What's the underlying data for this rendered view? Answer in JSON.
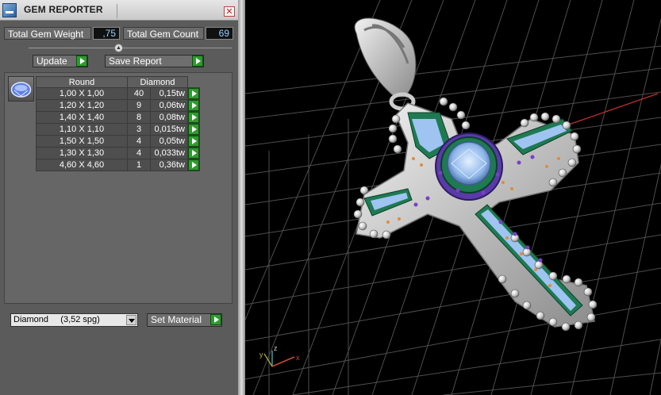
{
  "panel": {
    "title": "GEM REPORTER",
    "total_weight_label": "Total Gem Weight",
    "total_weight_value": ",75",
    "total_count_label": "Total Gem Count",
    "total_count_value": "69",
    "update_label": "Update",
    "save_report_label": "Save Report",
    "table": {
      "headers": [
        "Round",
        "Diamond"
      ],
      "rows": [
        {
          "size": "1,00 X 1,00",
          "count": "40",
          "weight": "0,15tw"
        },
        {
          "size": "1,20 X 1,20",
          "count": "9",
          "weight": "0,06tw"
        },
        {
          "size": "1,40 X 1,40",
          "count": "8",
          "weight": "0,08tw"
        },
        {
          "size": "1,10 X 1,10",
          "count": "3",
          "weight": "0,015tw"
        },
        {
          "size": "1,50 X 1,50",
          "count": "4",
          "weight": "0,05tw"
        },
        {
          "size": "1,30 X 1,30",
          "count": "4",
          "weight": "0,033tw"
        },
        {
          "size": "4,60 X 4,60",
          "count": "1",
          "weight": "0,36tw"
        }
      ]
    },
    "material_select": "Diamond     (3,52 spg)",
    "set_material_label": "Set Material"
  },
  "viewport": {
    "axis_labels": {
      "x": "x",
      "y": "y",
      "z": "z"
    },
    "grid_color": "#5a5a5a",
    "metal_color": "#d8d8d8",
    "enamel_color": "#1f7a52",
    "gem_color": "#9fc4f2"
  },
  "icons": {
    "app": "gem-reporter-app-icon",
    "close": "close-icon",
    "play": "green-play-arrow-icon",
    "thumb": "round-diamond-icon",
    "dropdown": "chevron-down-icon"
  }
}
